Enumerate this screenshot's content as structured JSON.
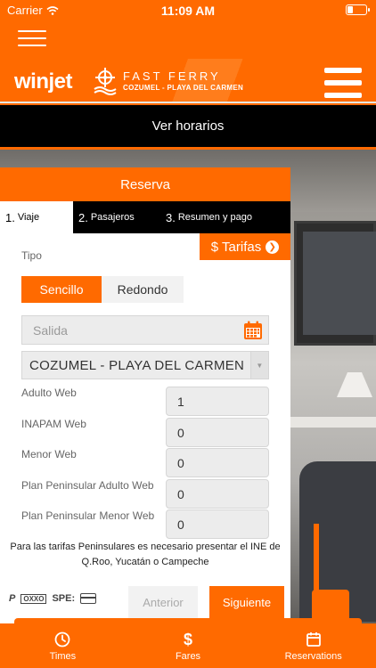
{
  "status_bar": {
    "carrier": "Carrier",
    "time": "11:09 AM"
  },
  "brand": {
    "name": "winjet",
    "product": "FAST FERRY",
    "route_tagline": "COZUMEL - PLAYA DEL CARMEN"
  },
  "header": {
    "horarios_label": "Ver horarios"
  },
  "reserva": {
    "title": "Reserva",
    "steps": [
      {
        "num": "1.",
        "label": "Viaje"
      },
      {
        "num": "2.",
        "label": "Pasajeros"
      },
      {
        "num": "3.",
        "label": "Resumen y pago"
      }
    ],
    "tarifas_label": "$ Tarifas",
    "tipo_label": "Tipo",
    "tipo_options": [
      "Sencillo",
      "Redondo"
    ],
    "salida_placeholder": "Salida",
    "route_selected": "COZUMEL - PLAYA DEL CARMEN",
    "passengers": [
      {
        "label": "Adulto Web",
        "value": "1"
      },
      {
        "label": "INAPAM Web",
        "value": "0"
      },
      {
        "label": "Menor Web",
        "value": "0"
      },
      {
        "label": "Plan Peninsular Adulto Web",
        "value": "0"
      },
      {
        "label": "Plan Peninsular Menor Web",
        "value": "0"
      }
    ],
    "notice": "Para las tarifas Peninsulares es necesario presentar el INE de Q.Roo, Yucatán o Campeche",
    "payment_icons": [
      "paypal-icon",
      "oxxo-icon",
      "spei-icon",
      "credit-card-icon"
    ],
    "payment_texts": {
      "paypal": "P",
      "oxxo": "OXXO",
      "spei": "SPE:"
    },
    "prev_label": "Anterior",
    "next_label": "Siguiente"
  },
  "tabbar": {
    "tabs": [
      {
        "label": "Times",
        "icon": "clock-icon"
      },
      {
        "label": "Fares",
        "icon": "dollar-icon"
      },
      {
        "label": "Reservations",
        "icon": "calendar-icon"
      }
    ]
  },
  "colors": {
    "accent": "#ff6a00",
    "dark": "#000000"
  }
}
